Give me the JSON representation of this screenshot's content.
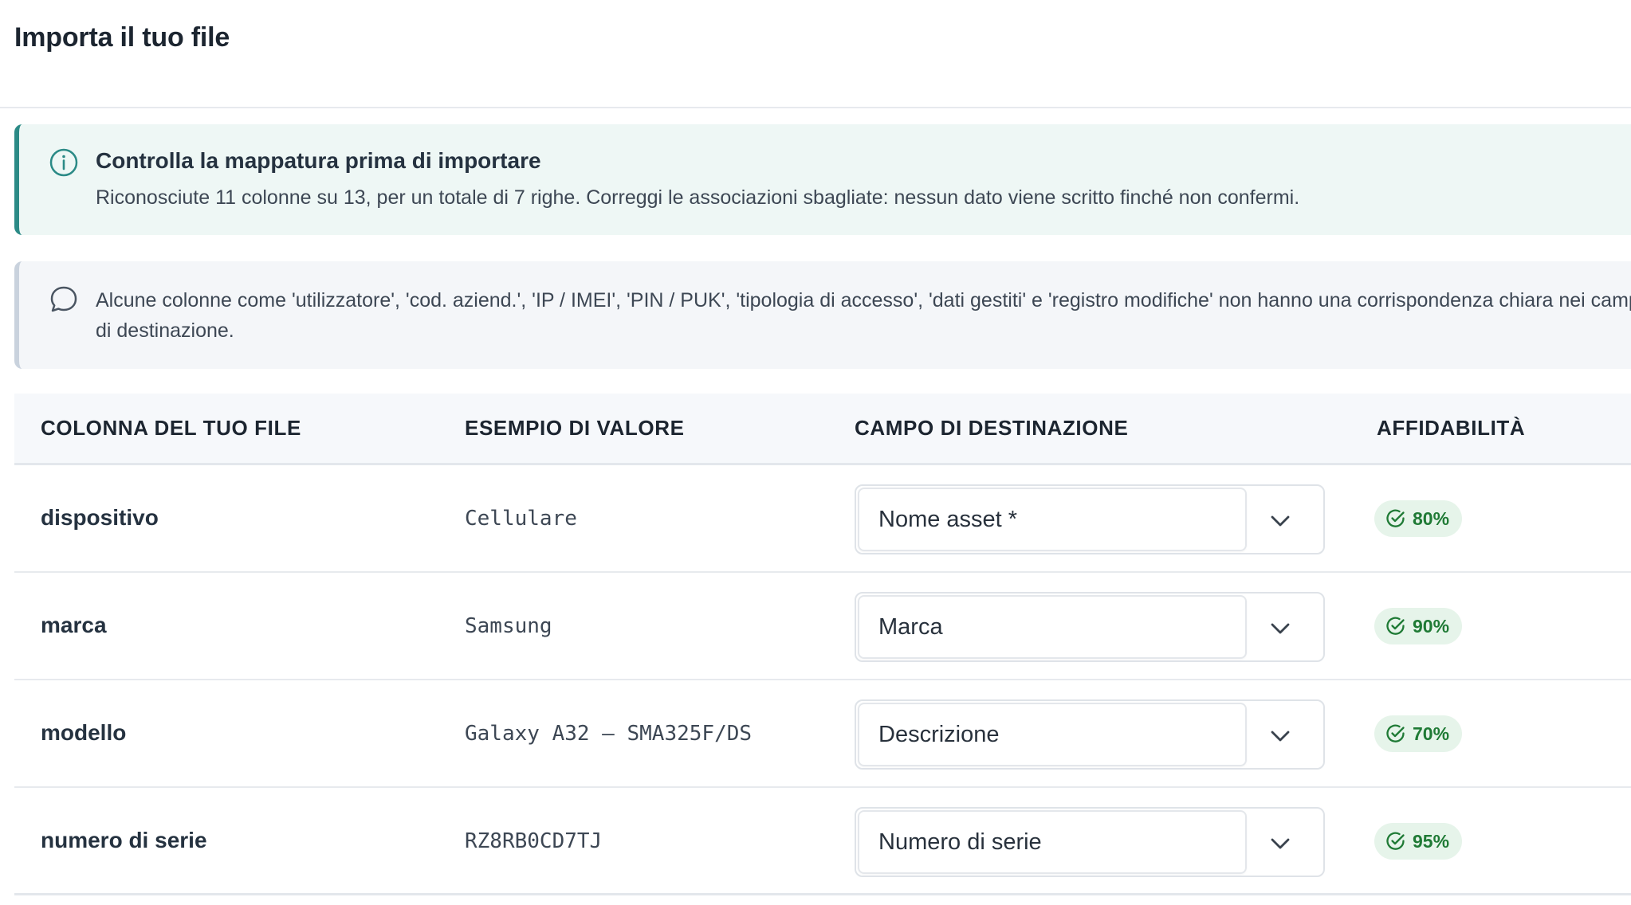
{
  "page": {
    "title": "Importa il tuo file"
  },
  "info_callout": {
    "icon": "info-circle-icon",
    "title": "Controlla la mappatura prima di importare",
    "body": "Riconosciute 11 colonne su 13, per un totale di 7 righe. Correggi le associazioni sbagliate: nessun dato viene scritto finché non confermi."
  },
  "note_callout": {
    "icon": "chat-bubble-icon",
    "body": "Alcune colonne come 'utilizzatore', 'cod. aziend.', 'IP / IMEI', 'PIN / PUK', 'tipologia di accesso', 'dati gestiti' e 'registro modifiche' non hanno una corrispondenza chiara nei campi di destinazione."
  },
  "table": {
    "headers": [
      "COLONNA DEL TUO FILE",
      "ESEMPIO DI VALORE",
      "CAMPO DI DESTINAZIONE",
      "AFFIDABILITÀ"
    ],
    "rows": [
      {
        "column": "dispositivo",
        "example": "Cellulare",
        "target": "Nome asset *",
        "confidence": "80%"
      },
      {
        "column": "marca",
        "example": "Samsung",
        "target": "Marca",
        "confidence": "90%"
      },
      {
        "column": "modello",
        "example": "Galaxy A32 – SMA325F/DS",
        "target": "Descrizione",
        "confidence": "70%"
      },
      {
        "column": "numero di serie",
        "example": "RZ8RB0CD7TJ",
        "target": "Numero di serie",
        "confidence": "95%"
      }
    ]
  },
  "colors": {
    "accent": "#2b8a86",
    "success": "#1f7a35",
    "success_bg": "#e6f4ea"
  }
}
